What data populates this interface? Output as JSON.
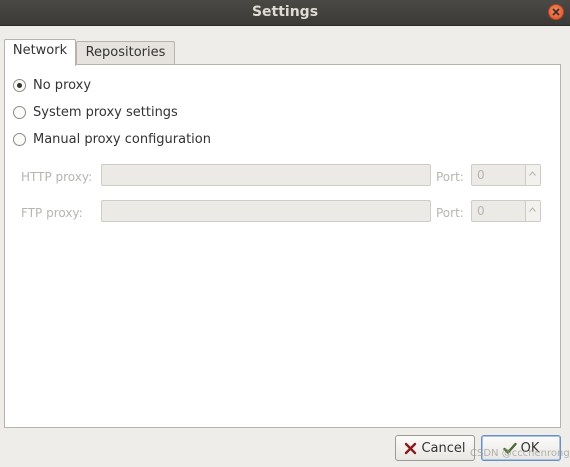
{
  "window": {
    "title": "Settings"
  },
  "tabs": [
    {
      "label": "Network",
      "active": true
    },
    {
      "label": "Repositories",
      "active": false
    }
  ],
  "proxy": {
    "options": [
      {
        "label": "No proxy",
        "checked": true
      },
      {
        "label": "System proxy settings",
        "checked": false
      },
      {
        "label": "Manual proxy configuration",
        "checked": false
      }
    ],
    "http": {
      "label": "HTTP proxy:",
      "value": "",
      "port_label": "Port:",
      "port_value": "0"
    },
    "ftp": {
      "label": "FTP proxy:",
      "value": "",
      "port_label": "Port:",
      "port_value": "0"
    }
  },
  "buttons": {
    "cancel": "Cancel",
    "ok": "OK"
  },
  "watermark": "CSDN @ccchenrong",
  "icons": {
    "close": "close-icon",
    "cancel": "cancel-x-icon",
    "ok": "checkmark-icon"
  },
  "colors": {
    "close_button": "#e0623b",
    "panel_bg": "#ffffff",
    "window_bg": "#efede9"
  }
}
